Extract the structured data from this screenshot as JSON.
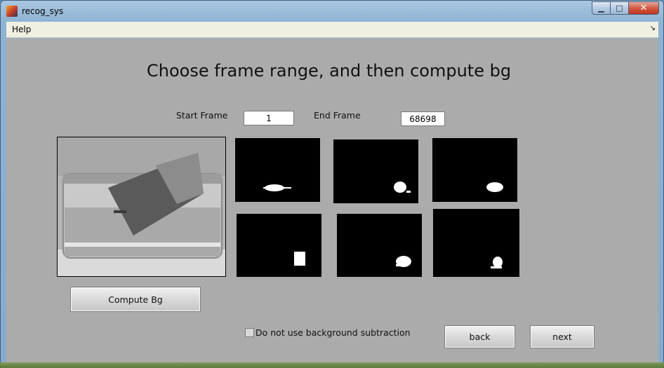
{
  "window": {
    "title": "recog_sys",
    "min_glyph": "▁",
    "max_glyph": "□",
    "close_glyph": "✕"
  },
  "menu": {
    "help_label": "Help",
    "overflow_glyph": "↘"
  },
  "main": {
    "heading": "Choose frame range, and then compute bg",
    "start_frame_label": "Start Frame",
    "start_frame_value": "1",
    "end_frame_label": "End Frame",
    "end_frame_value": "68698",
    "compute_bg_label": "Compute Bg",
    "no_bg_sub_label": "Do not use background subtraction",
    "no_bg_sub_checked": false,
    "back_label": "back",
    "next_label": "next"
  },
  "icons": {
    "app": "matlab-logo-icon"
  },
  "colors": {
    "client_bg": "#ababab",
    "mask_bg": "#000000",
    "blob": "#ffffff"
  }
}
